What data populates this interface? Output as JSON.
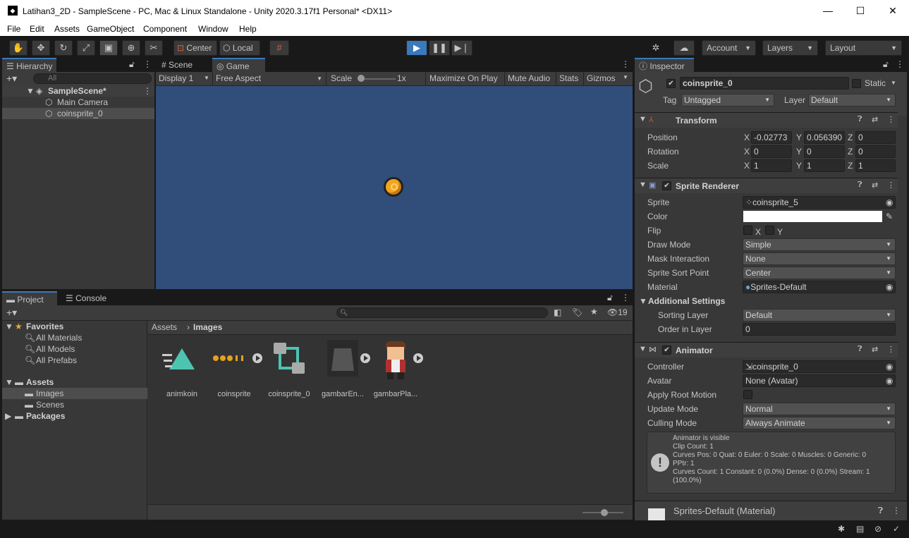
{
  "window": {
    "title": "Latihan3_2D - SampleScene - PC, Mac & Linux Standalone - Unity 2020.3.17f1 Personal* <DX11>",
    "minimize": "—",
    "maximize": "☐",
    "close": "✕"
  },
  "menu": [
    "File",
    "Edit",
    "Assets",
    "GameObject",
    "Component",
    "Window",
    "Help"
  ],
  "toolbar": {
    "center_label": "Center",
    "local_label": "Local",
    "account": "Account",
    "layers": "Layers",
    "layout": "Layout"
  },
  "hierarchy": {
    "tab": "Hierarchy",
    "search_placeholder": "All",
    "scene": "SampleScene*",
    "items": [
      "Main Camera",
      "coinsprite_0"
    ]
  },
  "game_view": {
    "tabs": [
      "Scene",
      "Game"
    ],
    "display": "Display 1",
    "aspect": "Free Aspect",
    "scale_label": "Scale",
    "scale_value": "1x",
    "maximize": "Maximize On Play",
    "mute": "Mute Audio",
    "stats": "Stats",
    "gizmos": "Gizmos",
    "bg_color": "#314d79"
  },
  "project": {
    "tabs": [
      "Project",
      "Console"
    ],
    "badge": "19",
    "breadcrumb": [
      "Assets",
      "Images"
    ],
    "favorites": {
      "label": "Favorites",
      "items": [
        "All Materials",
        "All Models",
        "All Prefabs"
      ]
    },
    "assets": {
      "label": "Assets",
      "children": [
        "Images",
        "Scenes"
      ]
    },
    "packages": "Packages",
    "files": [
      "animkoin",
      "coinsprite",
      "coinsprite_0",
      "gambarEn...",
      "gambarPla..."
    ]
  },
  "inspector": {
    "tab": "Inspector",
    "object_name": "coinsprite_0",
    "static_label": "Static",
    "tag_label": "Tag",
    "tag_value": "Untagged",
    "layer_label": "Layer",
    "layer_value": "Default",
    "transform": {
      "title": "Transform",
      "rows": [
        {
          "label": "Position",
          "x": "-0.02773",
          "y": "0.056390",
          "z": "0"
        },
        {
          "label": "Rotation",
          "x": "0",
          "y": "0",
          "z": "0"
        },
        {
          "label": "Scale",
          "x": "1",
          "y": "1",
          "z": "1"
        }
      ]
    },
    "sprite_renderer": {
      "title": "Sprite Renderer",
      "sprite_label": "Sprite",
      "sprite": "coinsprite_5",
      "color_label": "Color",
      "flip_label": "Flip",
      "flip_x": "X",
      "flip_y": "Y",
      "draw_mode_label": "Draw Mode",
      "draw_mode": "Simple",
      "mask_label": "Mask Interaction",
      "mask": "None",
      "sort_point_label": "Sprite Sort Point",
      "sort_point": "Center",
      "material_label": "Material",
      "material": "Sprites-Default",
      "additional_label": "Additional Settings",
      "sorting_layer_label": "Sorting Layer",
      "sorting_layer": "Default",
      "order_label": "Order in Layer",
      "order": "0"
    },
    "animator": {
      "title": "Animator",
      "controller_label": "Controller",
      "controller": "coinsprite_0",
      "avatar_label": "Avatar",
      "avatar": "None (Avatar)",
      "root_motion_label": "Apply Root Motion",
      "update_mode_label": "Update Mode",
      "update_mode": "Normal",
      "culling_label": "Culling Mode",
      "culling": "Always Animate",
      "info": [
        "Animator is visible",
        "Clip Count: 1",
        "Curves Pos: 0 Quat: 0 Euler: 0 Scale: 0 Muscles: 0 Generic: 0",
        "PPtr: 1",
        "Curves Count: 1 Constant: 0 (0.0%) Dense: 0 (0.0%) Stream: 1",
        "(100.0%)"
      ]
    },
    "material_footer": "Sprites-Default (Material)"
  }
}
